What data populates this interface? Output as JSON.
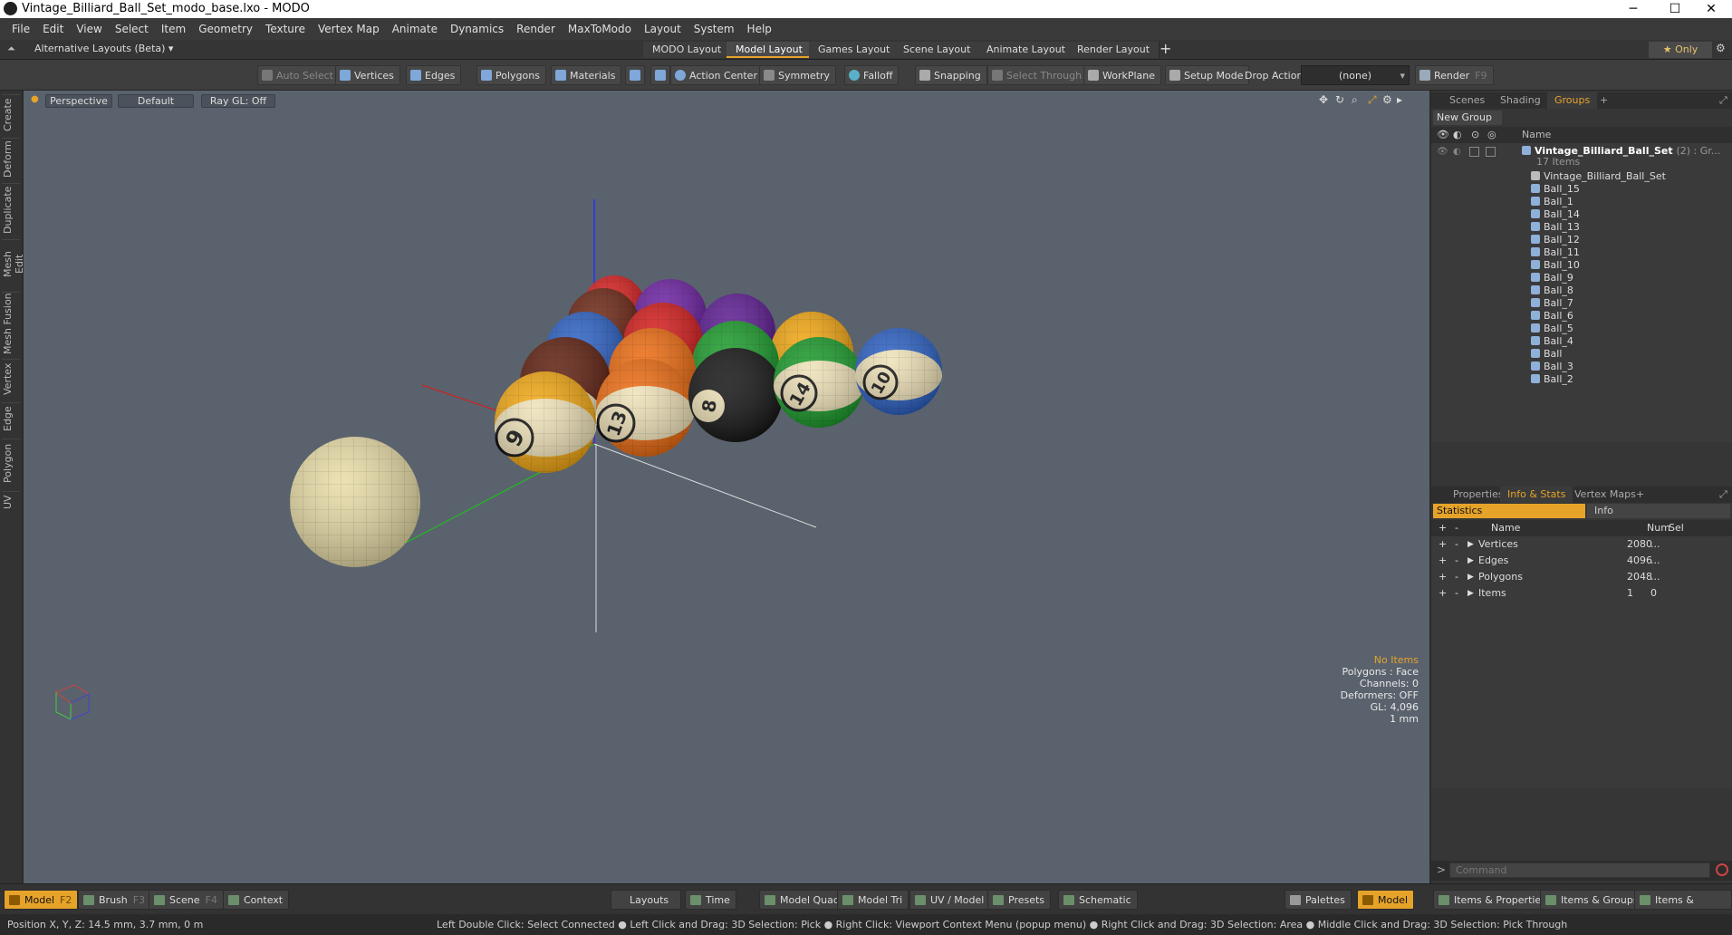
{
  "window": {
    "title": "Vintage_Billiard_Ball_Set_modo_base.lxo - MODO"
  },
  "menu": [
    "File",
    "Edit",
    "View",
    "Select",
    "Item",
    "Geometry",
    "Texture",
    "Vertex Map",
    "Animate",
    "Dynamics",
    "Render",
    "MaxToModo",
    "Layout",
    "System",
    "Help"
  ],
  "layoutbar": {
    "alt_layouts": "Alternative Layouts (Beta)",
    "tabs": [
      "MODO Layout",
      "Model Layout",
      "Games Layout",
      "Scene Layout",
      "Animate Layout",
      "Render Layout"
    ],
    "active_tab": "Model Layout",
    "add": "+",
    "only": "Only"
  },
  "toolbar": {
    "auto_select": "Auto Select",
    "vertices": "Vertices",
    "edges": "Edges",
    "polygons": "Polygons",
    "materials": "Materials",
    "action_center": "Action Center",
    "symmetry": "Symmetry",
    "falloff": "Falloff",
    "snapping": "Snapping",
    "select_through": "Select Through",
    "workplane": "WorkPlane",
    "setup_mode": "Setup Mode",
    "drop_action": "Drop Action",
    "drop_value": "(none)",
    "render": "Render",
    "render_key": "F9"
  },
  "lefttabs": [
    "Create",
    "Deform",
    "Duplicate",
    "Mesh Edit",
    "Mesh Fusion",
    "Vertex",
    "Edge",
    "Polygon",
    "UV"
  ],
  "viewport": {
    "view": "Perspective",
    "shading": "Default",
    "raygl": "Ray GL: Off",
    "info": {
      "items": "No Items",
      "polygons": "Polygons : Face",
      "channels": "Channels: 0",
      "deformers": "Deformers: OFF",
      "gl": "GL: 4,096",
      "unit": "1 mm"
    },
    "ball_numbers": [
      "9",
      "13",
      "8",
      "14",
      "10"
    ]
  },
  "colors": {
    "accent": "#e6a32a",
    "viewport_bg": "#5a626d"
  },
  "scene_panel": {
    "tabs": [
      "Scenes",
      "Shading",
      "Groups"
    ],
    "active_tab": "Groups",
    "new_group": "New Group",
    "col_name": "Name",
    "root": "Vintage_Billiard_Ball_Set",
    "root_suffix": "(2) : Gr...",
    "root_count": "17 Items",
    "items": [
      "Vintage_Billiard_Ball_Set",
      "Ball_15",
      "Ball_1",
      "Ball_14",
      "Ball_13",
      "Ball_12",
      "Ball_11",
      "Ball_10",
      "Ball_9",
      "Ball_8",
      "Ball_7",
      "Ball_6",
      "Ball_5",
      "Ball_4",
      "Ball",
      "Ball_3",
      "Ball_2"
    ]
  },
  "props_panel": {
    "tabs": [
      "Properties",
      "Info & Stats",
      "Vertex Maps"
    ],
    "active_tab": "Info & Stats",
    "sub_tabs": [
      "Statistics",
      "Info"
    ],
    "cols": {
      "name": "Name",
      "num": "Num",
      "sel": "Sel"
    },
    "rows": [
      {
        "name": "Vertices",
        "num": "2080",
        "sel": "..."
      },
      {
        "name": "Edges",
        "num": "4096",
        "sel": "..."
      },
      {
        "name": "Polygons",
        "num": "2048",
        "sel": "..."
      },
      {
        "name": "Items",
        "num": "1",
        "sel": "0"
      }
    ],
    "command_placeholder": "Command"
  },
  "bottombar": {
    "model": "Model",
    "model_key": "F2",
    "brush": "Brush",
    "brush_key": "F3",
    "scene": "Scene",
    "scene_key": "F4",
    "context": "Context",
    "layouts": "Layouts",
    "time": "Time",
    "model_quad": "Model Quad",
    "model_tri": "Model Tri",
    "uv_model": "UV / Model",
    "presets": "Presets",
    "schematic": "Schematic",
    "palettes": "Palettes",
    "model_right": "Model",
    "items_properties": "Items & Properties",
    "items_groups": "Items & Groups",
    "items_shading": "Items & Shading"
  },
  "status": {
    "position": "Position X, Y, Z:  14.5 mm, 3.7 mm, 0 m",
    "hints": "Left Double Click: Select Connected ● Left Click and Drag: 3D Selection: Pick ● Right Click: Viewport Context Menu (popup menu) ● Right Click and Drag: 3D Selection: Area ● Middle Click and Drag: 3D Selection: Pick Through"
  }
}
